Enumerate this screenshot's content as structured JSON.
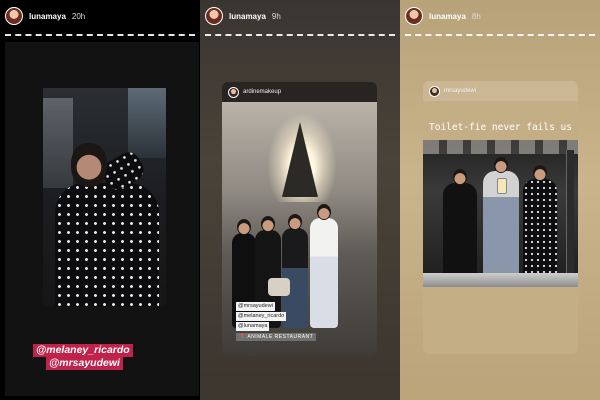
{
  "stories": [
    {
      "username": "lunamaya",
      "time": "20h",
      "mentions": [
        "@melaney_ricardo",
        "@mrsayudewi"
      ]
    },
    {
      "username": "lunamaya",
      "time": "9h",
      "card": {
        "username": "ardinemakeup",
        "tags": [
          "@mrsayudewi",
          "@melaney_ricardo",
          "@lunamaya"
        ],
        "location": "📍 ANIMALE RESTAURANT"
      }
    },
    {
      "username": "lunamaya",
      "time": "8h",
      "card": {
        "username": "mrsayudewi",
        "caption": "Toilet-fie never fails us"
      }
    }
  ]
}
